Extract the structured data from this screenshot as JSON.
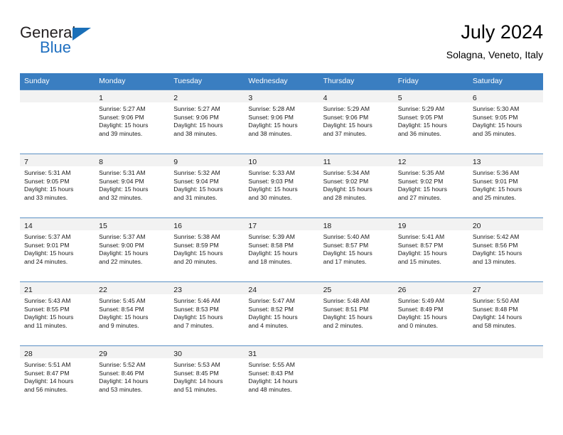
{
  "brand": {
    "name_top": "General",
    "name_bottom": "Blue",
    "triangle_color": "#1a6fb8",
    "blue_color": "#1f6fc0"
  },
  "header": {
    "title": "July 2024",
    "subtitle": "Solagna, Veneto, Italy"
  },
  "theme": {
    "header_bg": "#3a7ec1",
    "header_text": "#ffffff",
    "daynum_band_bg": "#f2f2f2",
    "cell_border": "#5a8fc4"
  },
  "weekdays": [
    "Sunday",
    "Monday",
    "Tuesday",
    "Wednesday",
    "Thursday",
    "Friday",
    "Saturday"
  ],
  "weeks": [
    [
      {
        "empty": true
      },
      {
        "day": "1",
        "sunrise": "Sunrise: 5:27 AM",
        "sunset": "Sunset: 9:06 PM",
        "daylight1": "Daylight: 15 hours",
        "daylight2": "and 39 minutes."
      },
      {
        "day": "2",
        "sunrise": "Sunrise: 5:27 AM",
        "sunset": "Sunset: 9:06 PM",
        "daylight1": "Daylight: 15 hours",
        "daylight2": "and 38 minutes."
      },
      {
        "day": "3",
        "sunrise": "Sunrise: 5:28 AM",
        "sunset": "Sunset: 9:06 PM",
        "daylight1": "Daylight: 15 hours",
        "daylight2": "and 38 minutes."
      },
      {
        "day": "4",
        "sunrise": "Sunrise: 5:29 AM",
        "sunset": "Sunset: 9:06 PM",
        "daylight1": "Daylight: 15 hours",
        "daylight2": "and 37 minutes."
      },
      {
        "day": "5",
        "sunrise": "Sunrise: 5:29 AM",
        "sunset": "Sunset: 9:05 PM",
        "daylight1": "Daylight: 15 hours",
        "daylight2": "and 36 minutes."
      },
      {
        "day": "6",
        "sunrise": "Sunrise: 5:30 AM",
        "sunset": "Sunset: 9:05 PM",
        "daylight1": "Daylight: 15 hours",
        "daylight2": "and 35 minutes."
      }
    ],
    [
      {
        "day": "7",
        "sunrise": "Sunrise: 5:31 AM",
        "sunset": "Sunset: 9:05 PM",
        "daylight1": "Daylight: 15 hours",
        "daylight2": "and 33 minutes."
      },
      {
        "day": "8",
        "sunrise": "Sunrise: 5:31 AM",
        "sunset": "Sunset: 9:04 PM",
        "daylight1": "Daylight: 15 hours",
        "daylight2": "and 32 minutes."
      },
      {
        "day": "9",
        "sunrise": "Sunrise: 5:32 AM",
        "sunset": "Sunset: 9:04 PM",
        "daylight1": "Daylight: 15 hours",
        "daylight2": "and 31 minutes."
      },
      {
        "day": "10",
        "sunrise": "Sunrise: 5:33 AM",
        "sunset": "Sunset: 9:03 PM",
        "daylight1": "Daylight: 15 hours",
        "daylight2": "and 30 minutes."
      },
      {
        "day": "11",
        "sunrise": "Sunrise: 5:34 AM",
        "sunset": "Sunset: 9:02 PM",
        "daylight1": "Daylight: 15 hours",
        "daylight2": "and 28 minutes."
      },
      {
        "day": "12",
        "sunrise": "Sunrise: 5:35 AM",
        "sunset": "Sunset: 9:02 PM",
        "daylight1": "Daylight: 15 hours",
        "daylight2": "and 27 minutes."
      },
      {
        "day": "13",
        "sunrise": "Sunrise: 5:36 AM",
        "sunset": "Sunset: 9:01 PM",
        "daylight1": "Daylight: 15 hours",
        "daylight2": "and 25 minutes."
      }
    ],
    [
      {
        "day": "14",
        "sunrise": "Sunrise: 5:37 AM",
        "sunset": "Sunset: 9:01 PM",
        "daylight1": "Daylight: 15 hours",
        "daylight2": "and 24 minutes."
      },
      {
        "day": "15",
        "sunrise": "Sunrise: 5:37 AM",
        "sunset": "Sunset: 9:00 PM",
        "daylight1": "Daylight: 15 hours",
        "daylight2": "and 22 minutes."
      },
      {
        "day": "16",
        "sunrise": "Sunrise: 5:38 AM",
        "sunset": "Sunset: 8:59 PM",
        "daylight1": "Daylight: 15 hours",
        "daylight2": "and 20 minutes."
      },
      {
        "day": "17",
        "sunrise": "Sunrise: 5:39 AM",
        "sunset": "Sunset: 8:58 PM",
        "daylight1": "Daylight: 15 hours",
        "daylight2": "and 18 minutes."
      },
      {
        "day": "18",
        "sunrise": "Sunrise: 5:40 AM",
        "sunset": "Sunset: 8:57 PM",
        "daylight1": "Daylight: 15 hours",
        "daylight2": "and 17 minutes."
      },
      {
        "day": "19",
        "sunrise": "Sunrise: 5:41 AM",
        "sunset": "Sunset: 8:57 PM",
        "daylight1": "Daylight: 15 hours",
        "daylight2": "and 15 minutes."
      },
      {
        "day": "20",
        "sunrise": "Sunrise: 5:42 AM",
        "sunset": "Sunset: 8:56 PM",
        "daylight1": "Daylight: 15 hours",
        "daylight2": "and 13 minutes."
      }
    ],
    [
      {
        "day": "21",
        "sunrise": "Sunrise: 5:43 AM",
        "sunset": "Sunset: 8:55 PM",
        "daylight1": "Daylight: 15 hours",
        "daylight2": "and 11 minutes."
      },
      {
        "day": "22",
        "sunrise": "Sunrise: 5:45 AM",
        "sunset": "Sunset: 8:54 PM",
        "daylight1": "Daylight: 15 hours",
        "daylight2": "and 9 minutes."
      },
      {
        "day": "23",
        "sunrise": "Sunrise: 5:46 AM",
        "sunset": "Sunset: 8:53 PM",
        "daylight1": "Daylight: 15 hours",
        "daylight2": "and 7 minutes."
      },
      {
        "day": "24",
        "sunrise": "Sunrise: 5:47 AM",
        "sunset": "Sunset: 8:52 PM",
        "daylight1": "Daylight: 15 hours",
        "daylight2": "and 4 minutes."
      },
      {
        "day": "25",
        "sunrise": "Sunrise: 5:48 AM",
        "sunset": "Sunset: 8:51 PM",
        "daylight1": "Daylight: 15 hours",
        "daylight2": "and 2 minutes."
      },
      {
        "day": "26",
        "sunrise": "Sunrise: 5:49 AM",
        "sunset": "Sunset: 8:49 PM",
        "daylight1": "Daylight: 15 hours",
        "daylight2": "and 0 minutes."
      },
      {
        "day": "27",
        "sunrise": "Sunrise: 5:50 AM",
        "sunset": "Sunset: 8:48 PM",
        "daylight1": "Daylight: 14 hours",
        "daylight2": "and 58 minutes."
      }
    ],
    [
      {
        "day": "28",
        "sunrise": "Sunrise: 5:51 AM",
        "sunset": "Sunset: 8:47 PM",
        "daylight1": "Daylight: 14 hours",
        "daylight2": "and 56 minutes."
      },
      {
        "day": "29",
        "sunrise": "Sunrise: 5:52 AM",
        "sunset": "Sunset: 8:46 PM",
        "daylight1": "Daylight: 14 hours",
        "daylight2": "and 53 minutes."
      },
      {
        "day": "30",
        "sunrise": "Sunrise: 5:53 AM",
        "sunset": "Sunset: 8:45 PM",
        "daylight1": "Daylight: 14 hours",
        "daylight2": "and 51 minutes."
      },
      {
        "day": "31",
        "sunrise": "Sunrise: 5:55 AM",
        "sunset": "Sunset: 8:43 PM",
        "daylight1": "Daylight: 14 hours",
        "daylight2": "and 48 minutes."
      },
      {
        "empty": true
      },
      {
        "empty": true
      },
      {
        "empty": true
      }
    ]
  ]
}
